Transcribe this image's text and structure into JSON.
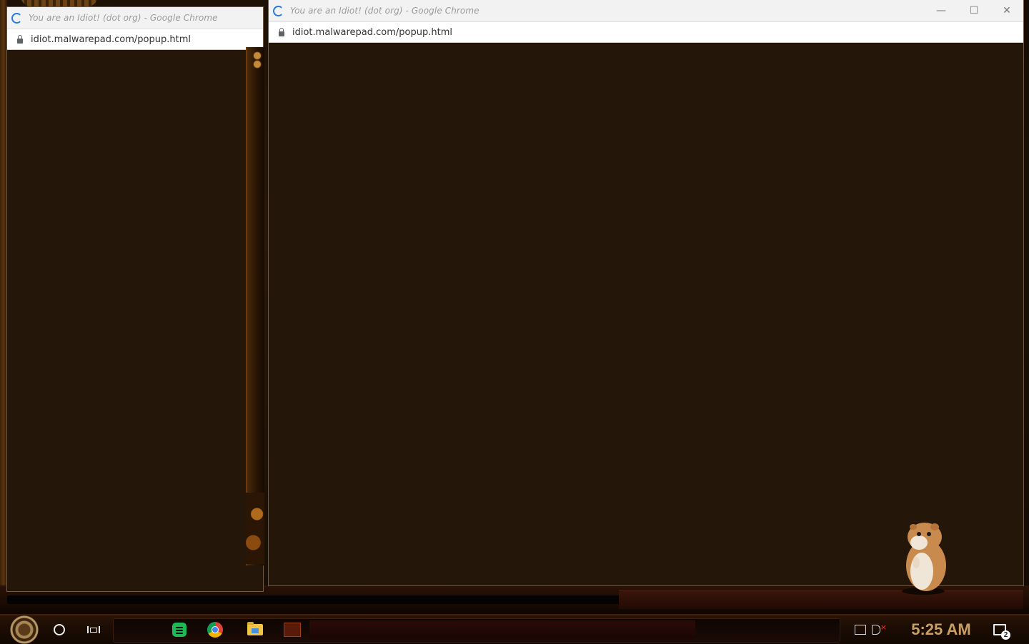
{
  "left_window": {
    "title": "You are an Idiot! (dot org) - Google Chrome",
    "url": "idiot.malwarepad.com/popup.html"
  },
  "right_window": {
    "title": "You are an Idiot! (dot org) - Google Chrome",
    "url": "idiot.malwarepad.com/popup.html",
    "minimize_glyph": "—",
    "maximize_glyph": "☐",
    "close_glyph": "✕"
  },
  "taskbar": {
    "clock": "5:25 AM",
    "notification_count": "2",
    "pinned": [
      "spotify-icon",
      "chrome-icon",
      "file-explorer-icon",
      "app-icon"
    ]
  },
  "colors": {
    "accent_clock": "#c9a064",
    "chrome_spinner": "#2a7ad9"
  }
}
